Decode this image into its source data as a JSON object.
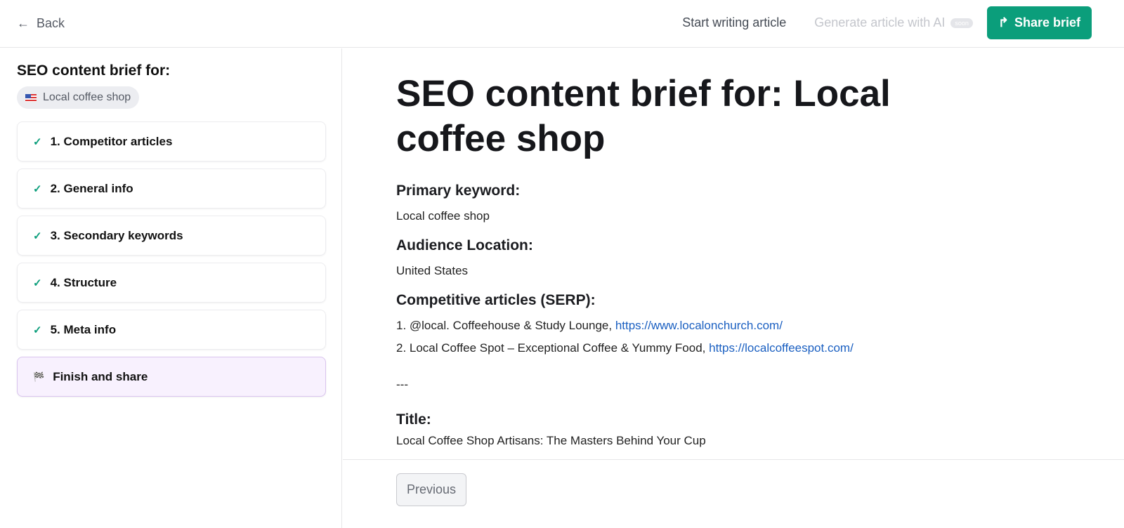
{
  "header": {
    "back": "Back",
    "start_writing": "Start writing article",
    "generate": "Generate article with AI",
    "soon_badge": "soon",
    "share": "Share brief",
    "accent": "#0b9e7b"
  },
  "sidebar": {
    "title": "SEO content brief for:",
    "keyword_chip": "Local coffee shop",
    "steps": [
      {
        "label": "1. Competitor articles",
        "icon": "check-icon"
      },
      {
        "label": "2. General info",
        "icon": "check-icon"
      },
      {
        "label": "3. Secondary keywords",
        "icon": "check-icon"
      },
      {
        "label": "4. Structure",
        "icon": "check-icon"
      },
      {
        "label": "5. Meta info",
        "icon": "check-icon"
      },
      {
        "label": "Finish and share",
        "icon": "checkered-flag-icon",
        "active": true
      }
    ]
  },
  "main": {
    "title": "SEO content brief for: Local coffee shop",
    "primary_label": "Primary keyword:",
    "primary_value": "Local coffee shop",
    "location_label": "Audience Location:",
    "location_value": "United States",
    "competitive_label": "Competitive articles (SERP):",
    "articles": [
      {
        "text": "1. @local. Coffeehouse & Study Lounge, ",
        "url": "https://www.localonchurch.com/"
      },
      {
        "text": "2. Local Coffee Spot – Exceptional Coffee & Yummy Food, ",
        "url": "https://localcoffeespot.com/"
      }
    ],
    "divider": "---",
    "title_label": "Title:",
    "title_value": "Local Coffee Shop Artisans: The Masters Behind Your Cup"
  },
  "footer": {
    "previous": "Previous"
  }
}
